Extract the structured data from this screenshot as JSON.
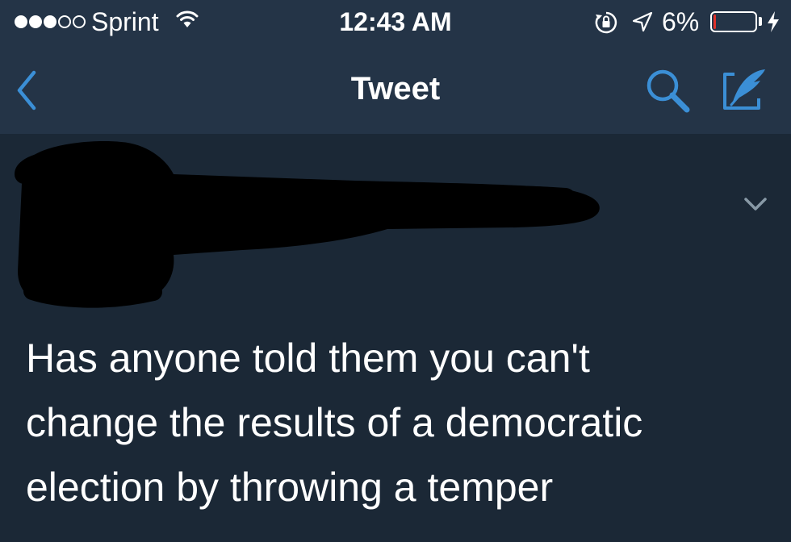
{
  "status_bar": {
    "carrier": "Sprint",
    "signal_bars_filled": 3,
    "signal_bars_total": 5,
    "time": "12:43 AM",
    "battery_percent": "6%",
    "battery_level": 0.06,
    "battery_color": "#e0302a",
    "icons": [
      "wifi-icon",
      "rotation-lock-icon",
      "location-arrow-icon",
      "battery-icon",
      "charging-bolt-icon"
    ]
  },
  "nav": {
    "title": "Tweet",
    "back_icon": "chevron-left-icon",
    "search_icon": "search-icon",
    "compose_icon": "compose-quill-icon"
  },
  "tweet": {
    "author_redacted": true,
    "menu_icon": "chevron-down-icon",
    "text": "Has anyone told them you can't\nchange the results of a democratic\nelection by throwing a temper"
  },
  "colors": {
    "accent": "#1da1f2",
    "nav_icon": "#3b8fd6",
    "header_bg": "#243447",
    "content_bg": "#1b2836",
    "text": "#ffffff",
    "muted": "#8899a6"
  }
}
